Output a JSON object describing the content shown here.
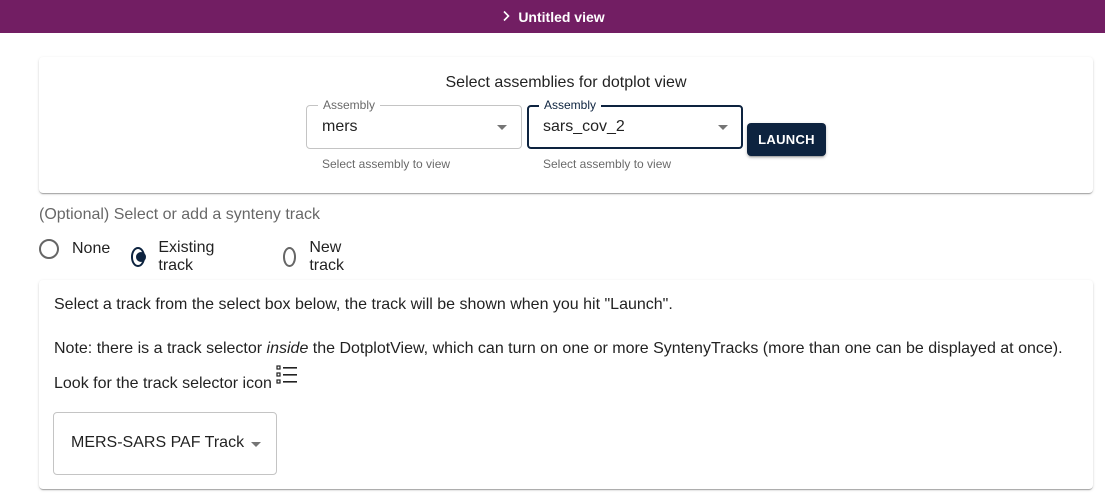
{
  "header": {
    "title": "Untitled view",
    "icon": "chevron-right-icon",
    "background": "#721e63"
  },
  "assembly_card": {
    "title": "Select assemblies for dotplot view",
    "selectors": [
      {
        "legend": "Assembly",
        "value": "mers",
        "helper": "Select assembly to view"
      },
      {
        "legend": "Assembly",
        "value": "sars_cov_2",
        "helper": "Select assembly to view"
      }
    ],
    "launch_label": "LAUNCH",
    "accent": "#0d233f"
  },
  "synteny": {
    "label": "(Optional) Select or add a synteny track",
    "options": [
      {
        "label": "None",
        "checked": false
      },
      {
        "label": "Existing track",
        "checked": true
      },
      {
        "label": "New track",
        "checked": false
      }
    ]
  },
  "track_card": {
    "instruction": "Select a track from the select box below, the track will be shown when you hit \"Launch\".",
    "note_prefix": "Note: there is a track selector ",
    "note_emphasis": "inside",
    "note_suffix": " the DotplotView, which can turn on one or more SyntenyTracks (more than one can be displayed at once). Look for the track selector icon",
    "note_icon": "format-list-bulleted-icon",
    "track_value": "MERS-SARS PAF Track"
  }
}
